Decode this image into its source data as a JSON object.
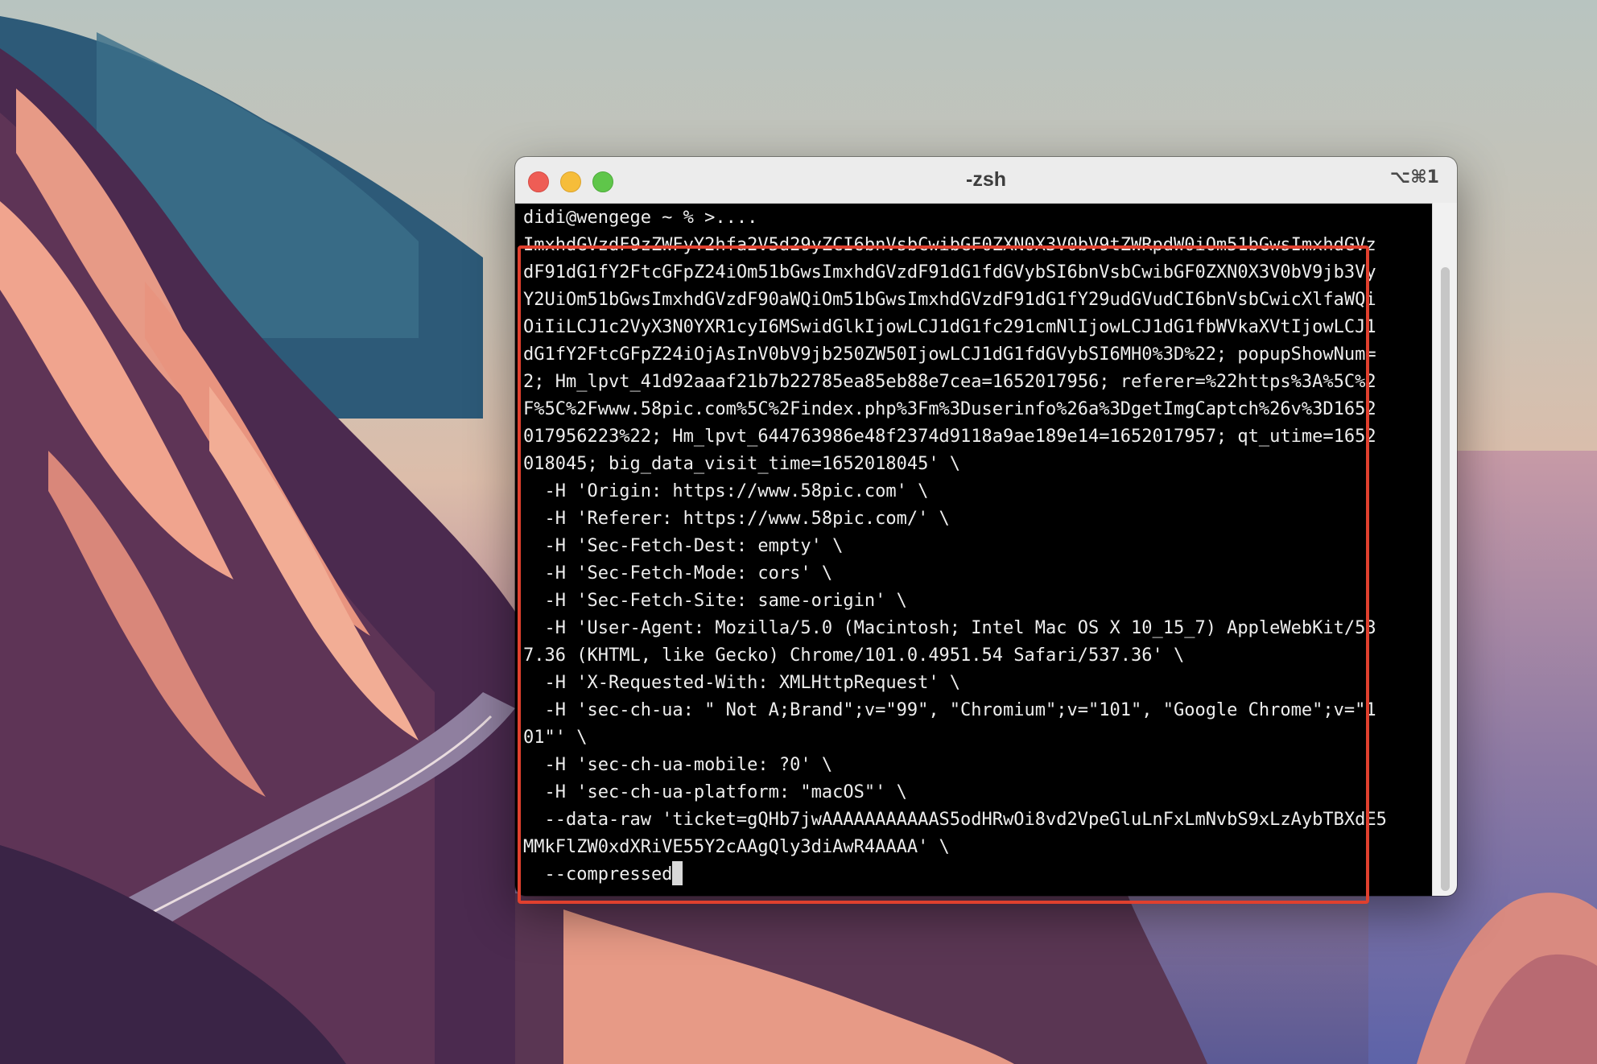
{
  "window": {
    "title": "-zsh",
    "shortcut": "⌥⌘1"
  },
  "terminal": {
    "lines": [
      "didi@wengege ~ % >....",
      "ImxhdGVzdF9zZWFyY2hfa2V5d29yZCI6bnVsbCwibGF0ZXN0X3V0bV9tZWRpdW0iOm51bGwsImxhdGVz",
      "dF91dG1fY2FtcGFpZ24iOm51bGwsImxhdGVzdF91dG1fdGVybSI6bnVsbCwibGF0ZXN0X3V0bV9jb3Vy",
      "Y2UiOm51bGwsImxhdGVzdF90aWQiOm51bGwsImxhdGVzdF91dG1fY29udGVudCI6bnVsbCwicXlfaWQi",
      "OiIiLCJ1c2VyX3N0YXR1cyI6MSwidGlkIjowLCJ1dG1fc291cmNlIjowLCJ1dG1fbWVkaXVtIjowLCJ1",
      "dG1fY2FtcGFpZ24iOjAsInV0bV9jb250ZW50IjowLCJ1dG1fdGVybSI6MH0%3D%22; popupShowNum=",
      "2; Hm_lpvt_41d92aaaf21b7b22785ea85eb88e7cea=1652017956; referer=%22https%3A%5C%2",
      "F%5C%2Fwww.58pic.com%5C%2Findex.php%3Fm%3Duserinfo%26a%3DgetImgCaptch%26v%3D1652",
      "017956223%22; Hm_lpvt_644763986e48f2374d9118a9ae189e14=1652017957; qt_utime=1652",
      "018045; big_data_visit_time=1652018045' \\",
      "  -H 'Origin: https://www.58pic.com' \\",
      "  -H 'Referer: https://www.58pic.com/' \\",
      "  -H 'Sec-Fetch-Dest: empty' \\",
      "  -H 'Sec-Fetch-Mode: cors' \\",
      "  -H 'Sec-Fetch-Site: same-origin' \\",
      "  -H 'User-Agent: Mozilla/5.0 (Macintosh; Intel Mac OS X 10_15_7) AppleWebKit/53",
      "7.36 (KHTML, like Gecko) Chrome/101.0.4951.54 Safari/537.36' \\",
      "  -H 'X-Requested-With: XMLHttpRequest' \\",
      "  -H 'sec-ch-ua: \" Not A;Brand\";v=\"99\", \"Chromium\";v=\"101\", \"Google Chrome\";v=\"1",
      "01\"' \\",
      "  -H 'sec-ch-ua-mobile: ?0' \\",
      "  -H 'sec-ch-ua-platform: \"macOS\"' \\",
      "  --data-raw 'ticket=gQHb7jwAAAAAAAAAAAS5odHRwOi8vd2VpeGluLnFxLmNvbS9xLzAybTBXdE5",
      "MMkFlZW0xdXRiVE55Y2cAAgQly3diAwR4AAAA' \\",
      "  --compressed"
    ]
  },
  "colors": {
    "terminal_bg": "#000000",
    "terminal_fg": "#eeeeee",
    "highlight": "#e0402e",
    "titlebar": "#ececec"
  }
}
